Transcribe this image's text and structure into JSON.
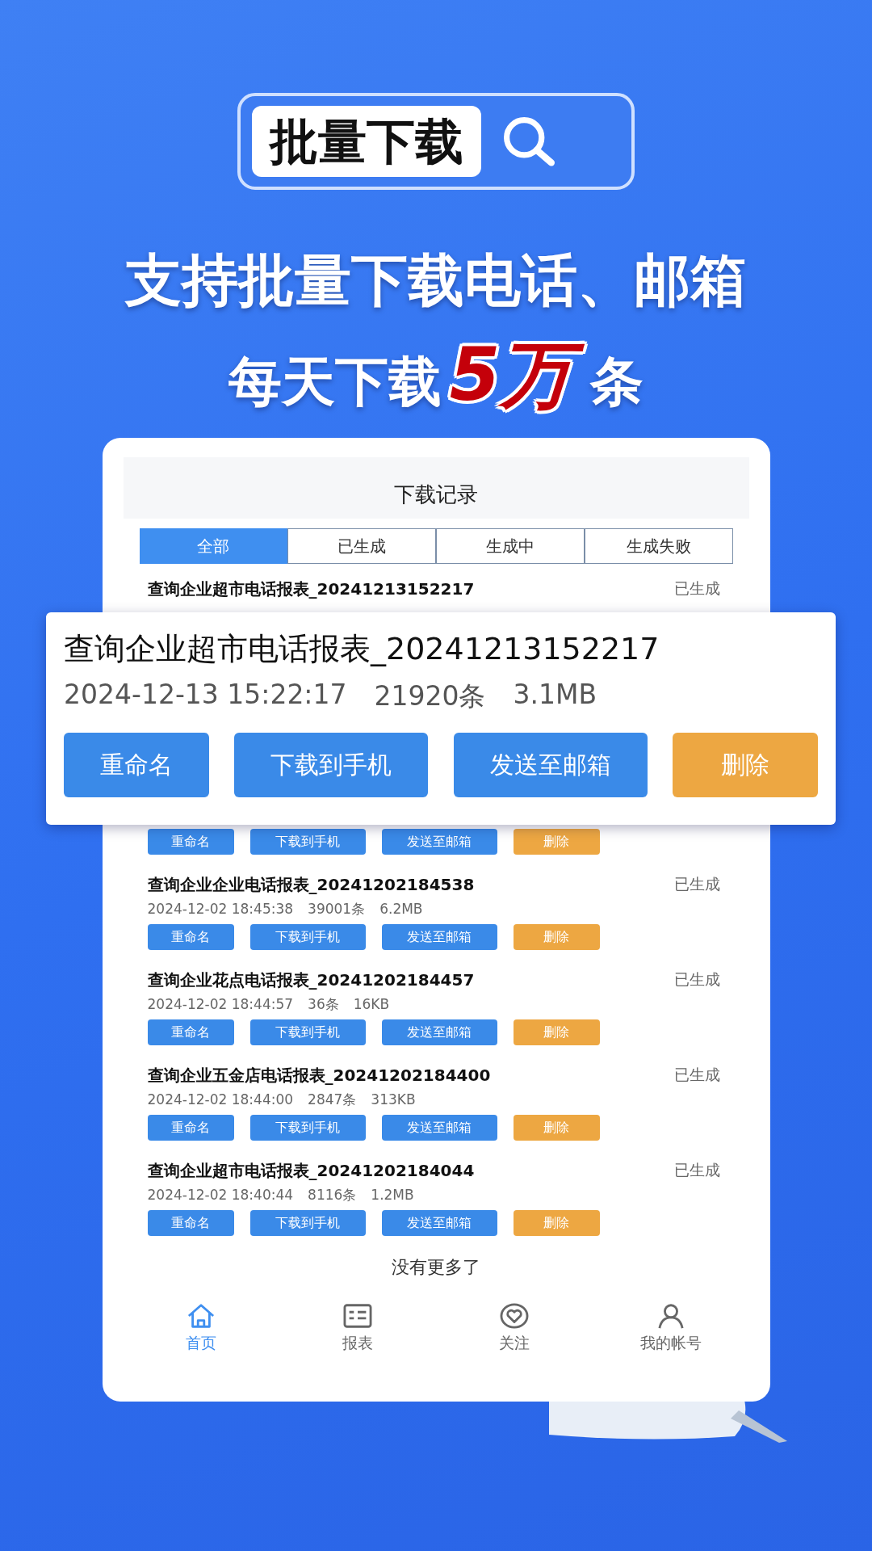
{
  "search_banner": {
    "label": "批量下载"
  },
  "headline": "支持批量下载电话、邮箱",
  "subheadline": [
    {
      "text": "每天下载",
      "kind": "plain"
    },
    {
      "text": "5万",
      "kind": "highlight"
    },
    {
      "text": "条",
      "kind": "plain"
    }
  ],
  "app": {
    "title": "下载记录",
    "tabs": [
      {
        "label": "全部",
        "selected": true
      },
      {
        "label": "已生成",
        "selected": false
      },
      {
        "label": "生成中",
        "selected": false
      },
      {
        "label": "生成失败",
        "selected": false
      }
    ],
    "records": [
      {
        "title": "查询企业超市电话报表_20241213152217",
        "status": "已生成",
        "actions": [
          {
            "label": "重命名",
            "kind": "primary"
          },
          {
            "label": "下载到手机",
            "kind": "primary"
          },
          {
            "label": "发送至邮箱",
            "kind": "primary"
          },
          {
            "label": "删除",
            "kind": "danger"
          }
        ]
      },
      {
        "title": "查询企业企业电话报表_20241202184538",
        "status": "已生成",
        "date": "2024-12-02 18:45:38",
        "count": "39001条",
        "size": "6.2MB",
        "actions": [
          {
            "label": "重命名",
            "kind": "primary"
          },
          {
            "label": "下载到手机",
            "kind": "primary"
          },
          {
            "label": "发送至邮箱",
            "kind": "primary"
          },
          {
            "label": "删除",
            "kind": "danger"
          }
        ]
      },
      {
        "title": "查询企业花点电话报表_20241202184457",
        "status": "已生成",
        "date": "2024-12-02 18:44:57",
        "count": "36条",
        "size": "16KB",
        "actions": [
          {
            "label": "重命名",
            "kind": "primary"
          },
          {
            "label": "下载到手机",
            "kind": "primary"
          },
          {
            "label": "发送至邮箱",
            "kind": "primary"
          },
          {
            "label": "删除",
            "kind": "danger"
          }
        ]
      },
      {
        "title": "查询企业五金店电话报表_20241202184400",
        "status": "已生成",
        "date": "2024-12-02 18:44:00",
        "count": "2847条",
        "size": "313KB",
        "actions": [
          {
            "label": "重命名",
            "kind": "primary"
          },
          {
            "label": "下载到手机",
            "kind": "primary"
          },
          {
            "label": "发送至邮箱",
            "kind": "primary"
          },
          {
            "label": "删除",
            "kind": "danger"
          }
        ]
      },
      {
        "title": "查询企业超市电话报表_20241202184044",
        "status": "已生成",
        "date": "2024-12-02 18:40:44",
        "count": "8116条",
        "size": "1.2MB",
        "actions": [
          {
            "label": "重命名",
            "kind": "primary"
          },
          {
            "label": "下载到手机",
            "kind": "primary"
          },
          {
            "label": "发送至邮箱",
            "kind": "primary"
          },
          {
            "label": "删除",
            "kind": "danger"
          }
        ]
      }
    ],
    "end_text": "没有更多了",
    "nav": [
      {
        "label": "首页",
        "kind": "home",
        "selected": true
      },
      {
        "label": "报表",
        "kind": "report",
        "selected": false
      },
      {
        "label": "关注",
        "kind": "follow",
        "selected": false
      },
      {
        "label": "我的帐号",
        "kind": "account",
        "selected": false
      }
    ]
  },
  "popup": {
    "title": "查询企业超市电话报表_20241213152217",
    "date": "2024-12-13 15:22:17",
    "count": "21920条",
    "size": "3.1MB",
    "actions": [
      {
        "label": "重命名",
        "kind": "primary"
      },
      {
        "label": "下载到手机",
        "kind": "primary"
      },
      {
        "label": "发送至邮箱",
        "kind": "primary"
      },
      {
        "label": "删除",
        "kind": "danger"
      }
    ]
  }
}
